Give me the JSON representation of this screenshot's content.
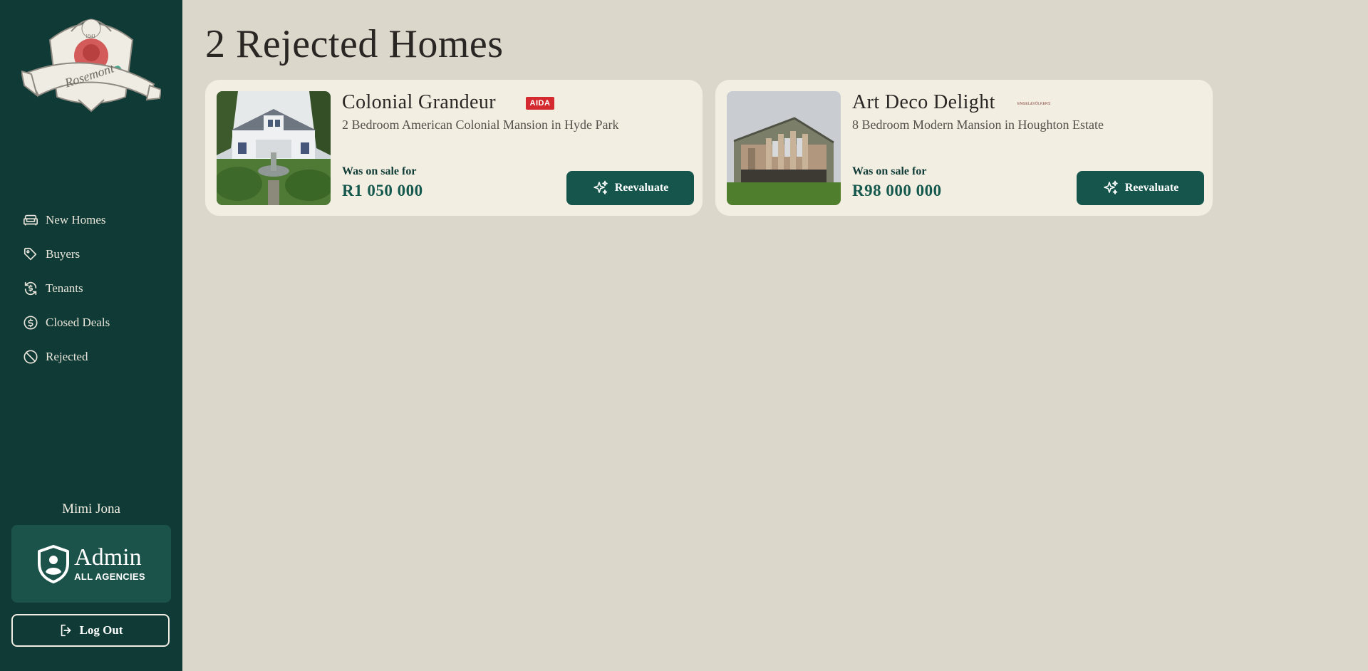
{
  "app": {
    "logo_text": "Rosemont",
    "logo_year": "1941"
  },
  "sidebar": {
    "items": [
      {
        "label": "New Homes",
        "icon": "sofa-icon"
      },
      {
        "label": "Buyers",
        "icon": "tag-icon"
      },
      {
        "label": "Tenants",
        "icon": "refresh-dollar-icon"
      },
      {
        "label": "Closed Deals",
        "icon": "dollar-circle-icon"
      },
      {
        "label": "Rejected",
        "icon": "ban-icon"
      }
    ]
  },
  "user": {
    "name": "Mimi Jona",
    "role_title": "Admin",
    "role_sub": "ALL AGENCIES",
    "logout_label": "Log Out"
  },
  "page": {
    "title": "2 Rejected Homes"
  },
  "cards": [
    {
      "title": "Colonial Grandeur",
      "agency": "AIDA",
      "subtitle": "2 Bedroom American Colonial Mansion in Hyde Park",
      "was_label": "Was on sale for",
      "price": "R1 050 000",
      "button_label": "Reevaluate"
    },
    {
      "title": "Art Deco Delight",
      "agency": "ENGEL&VÖLKERS",
      "subtitle": "8 Bedroom Modern Mansion in Houghton Estate",
      "was_label": "Was on sale for",
      "price": "R98 000 000",
      "button_label": "Reevaluate"
    }
  ],
  "colors": {
    "sidebar": "#0f3a35",
    "accent": "#15554b",
    "background": "#dcd7cb",
    "card": "#f2eee2",
    "agency_red": "#d42a2f"
  }
}
